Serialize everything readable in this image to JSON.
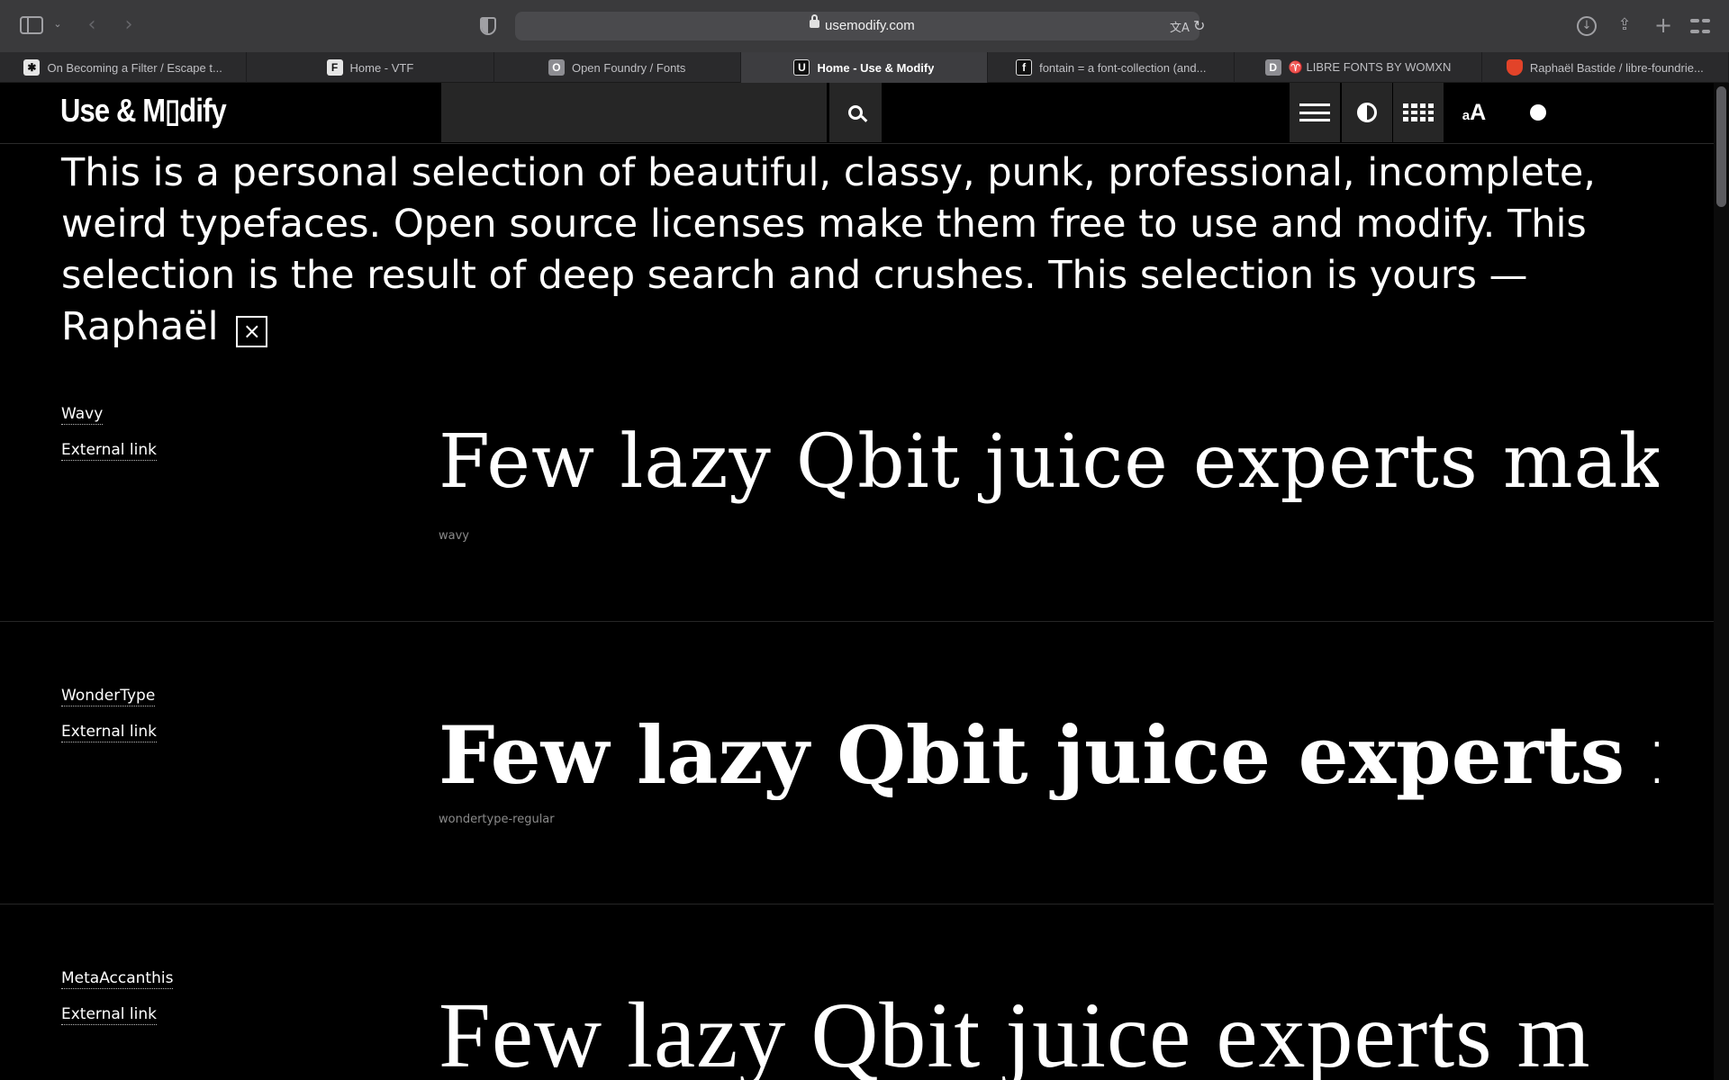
{
  "browser": {
    "url": "usemodify.com",
    "icons": [
      "sidebar-icon",
      "chevron-down-icon",
      "back-arrow-icon",
      "forward-arrow-icon",
      "privacy-shield-icon",
      "lock-icon",
      "translate-icon",
      "reload-icon",
      "download-icon",
      "share-icon",
      "new-tab-icon",
      "tab-overview-icon"
    ],
    "tabs": [
      {
        "label": "On Becoming a Filter / Escape t...",
        "favicon": "✱"
      },
      {
        "label": "Home - VTF",
        "favicon": "F"
      },
      {
        "label": "Open Foundry / Fonts",
        "favicon": "O"
      },
      {
        "label": "Home - Use & Modify",
        "favicon": "U",
        "active": true
      },
      {
        "label": "fontain = a font-collection (and...",
        "favicon": "f"
      },
      {
        "label": "♈ LIBRE FONTS BY WOMXN",
        "favicon": "D"
      },
      {
        "label": "Raphaël Bastide / libre-foundrie...",
        "favicon": ""
      }
    ]
  },
  "site": {
    "logo": "Use & M▯dify",
    "search_placeholder": "",
    "size_toggle": {
      "small": "a",
      "big": "A"
    },
    "header_icons": [
      "search-icon",
      "list-view-icon",
      "contrast-icon",
      "grid-view-icon",
      "text-size-icon",
      "color-dot-icon"
    ]
  },
  "intro": {
    "text": "This is a personal selection of beautiful, classy, punk, professional, incomplete, weird typefaces. Open source licenses make them free to use and modify. This selection is the result of deep search and crushes. This selection is yours — Raphaël",
    "close": "×"
  },
  "fonts": [
    {
      "name": "Wavy",
      "link": "External link",
      "specimen": "Few lazy Qbit juice experts make c",
      "slug": "wavy"
    },
    {
      "name": "WonderType",
      "link": "External link",
      "specimen": "Few lazy Qbit juice experts make",
      "slug": "wondertype-regular"
    },
    {
      "name": "MetaAccanthis",
      "link": "External link",
      "specimen": "Few lazy Qbit juice experts m",
      "slug": ""
    }
  ],
  "colors": {
    "background": "#000000",
    "text": "#ffffff",
    "toolbar": "#3a3a3c",
    "header_button": "#262626",
    "muted": "#8a8a8a"
  }
}
